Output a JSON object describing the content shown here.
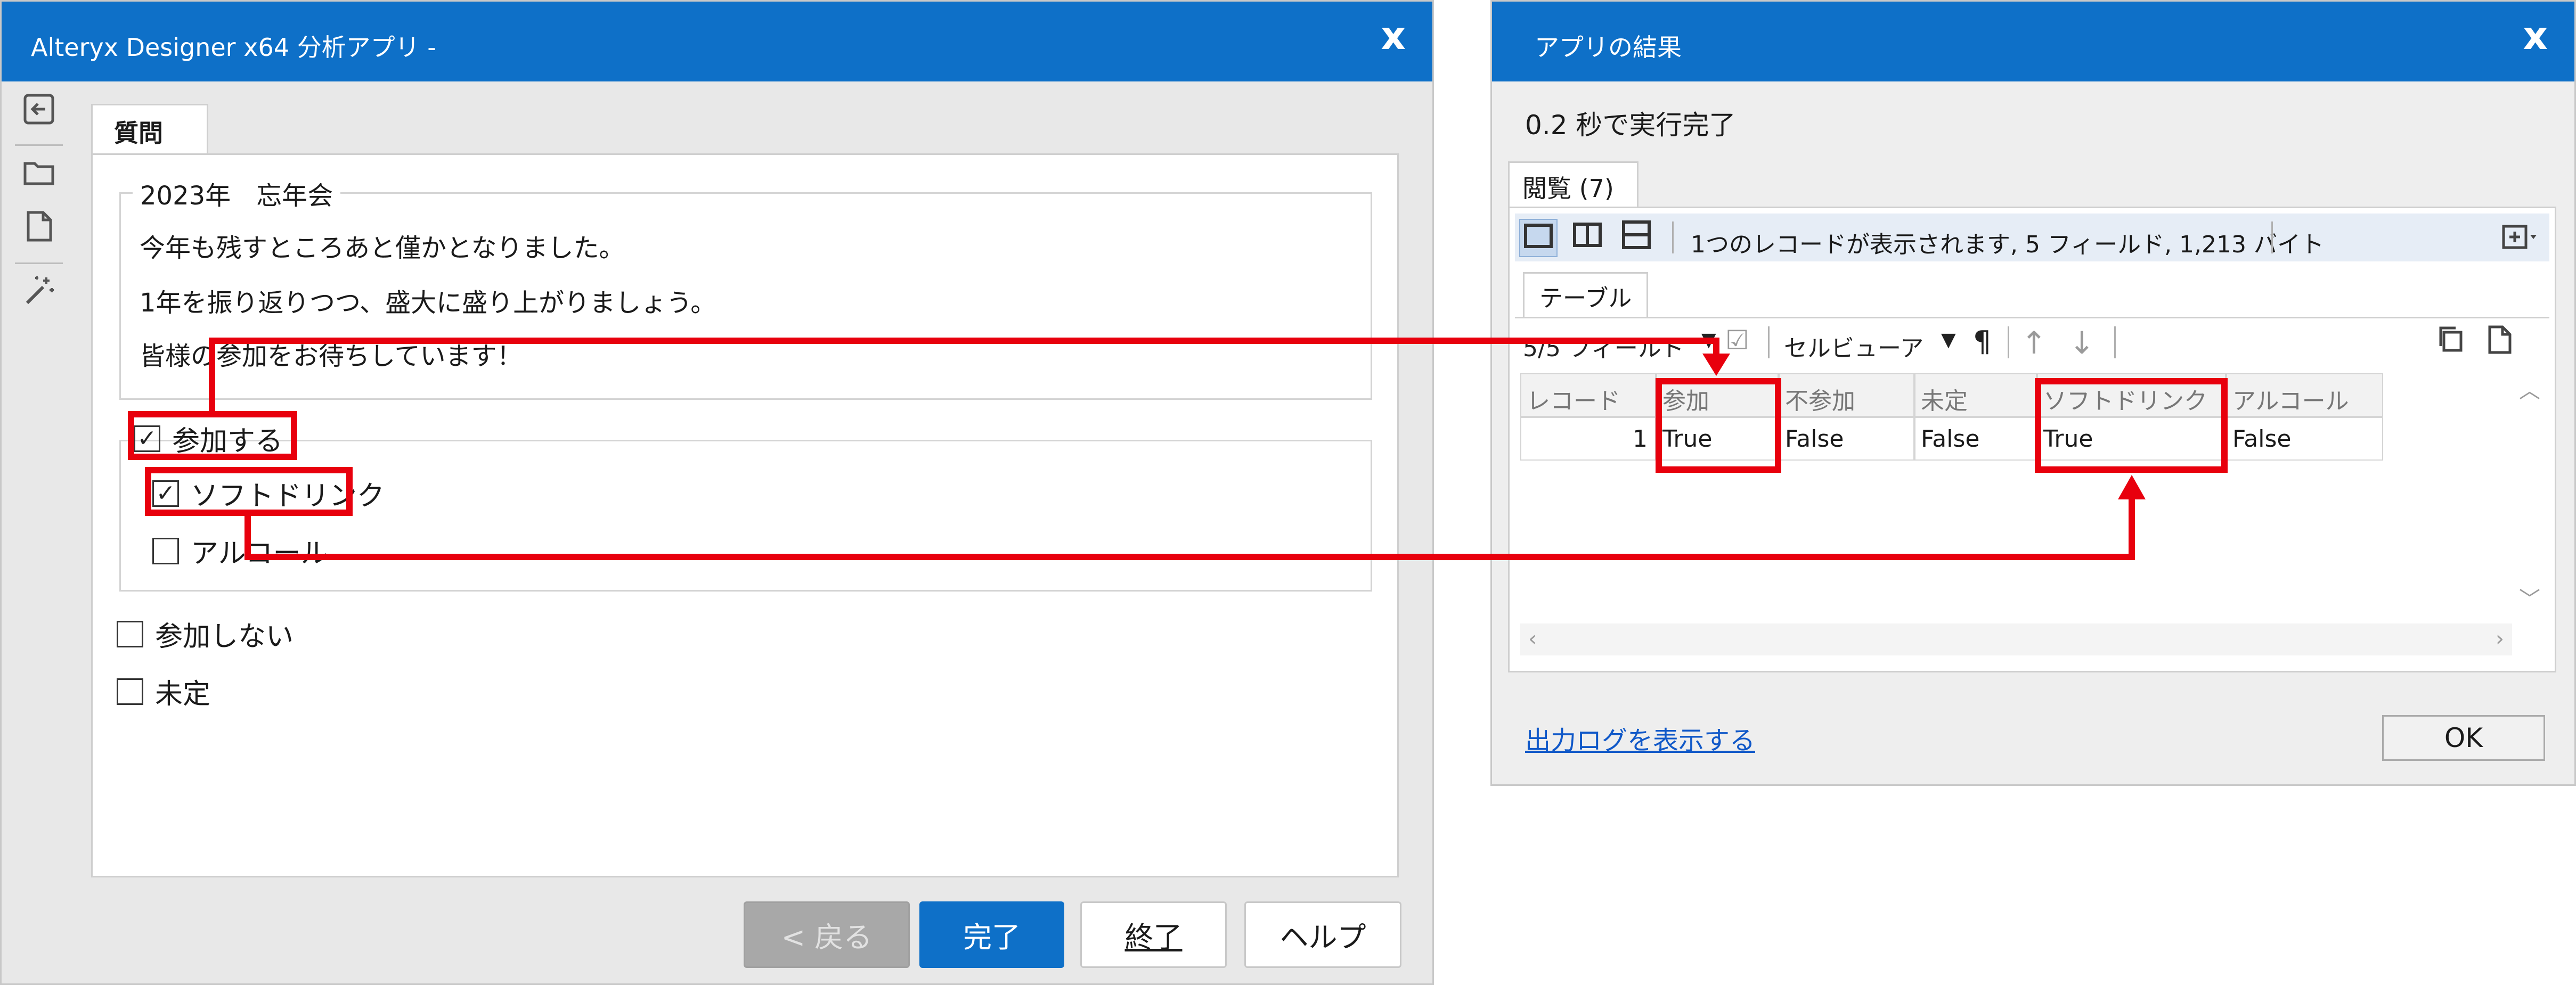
{
  "colors": {
    "titlebar": "#0e70c8",
    "annotation": "#e8000d",
    "link": "#1058c8"
  },
  "window_app": {
    "title": "Alteryx Designer x64 分析アプリ -",
    "close": "x",
    "sidebar": [
      "back-icon",
      "folder-open-icon",
      "document-icon",
      "magic-wand-icon"
    ],
    "tab_label": "質問",
    "group": {
      "legend": "2023年　忘年会",
      "lines": [
        "今年も残すところあと僅かとなりました。",
        "1年を振り返りつつ、盛大に盛り上がりましょう。",
        "皆様の参加をお待ちしています！"
      ]
    },
    "options": [
      {
        "label": "参加する",
        "checked": true
      },
      {
        "label": "ソフトドリンク",
        "checked": true
      },
      {
        "label": "アルコール",
        "checked": false
      },
      {
        "label": "参加しない",
        "checked": false
      },
      {
        "label": "未定",
        "checked": false
      }
    ],
    "buttons": {
      "back": "< 戻る",
      "finish": "完了",
      "exit": "終了",
      "help": "ヘルプ"
    }
  },
  "window_results": {
    "title": "アプリの結果",
    "close": "x",
    "status": "0.2 秒で実行完了",
    "tab_label": "閲覧 (7)",
    "info": "1つのレコードが表示されます, 5 フィールド, 1,213 バイト",
    "subtab": "テーブル",
    "toolbar": {
      "fields": "5/5 フィールド",
      "cell_viewer": "セルビューア",
      "pilcrow": "¶"
    },
    "table": {
      "headers": [
        "レコード",
        "参加",
        "不参加",
        "未定",
        "ソフトドリンク",
        "アルコール"
      ],
      "rows": [
        [
          "1",
          "True",
          "False",
          "False",
          "True",
          "False"
        ]
      ]
    },
    "log_link": "出力ログを表示する",
    "ok": "OK"
  }
}
